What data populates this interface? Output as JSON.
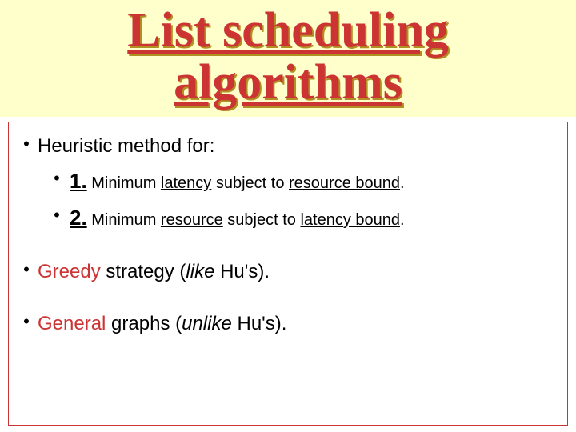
{
  "title": {
    "line1": "List scheduling",
    "line2": "algorithms"
  },
  "content": {
    "heuristic_label": "Heuristic method for:",
    "item1": {
      "num": "1.",
      "pre": " Minimum ",
      "latency": "latency",
      "mid": " subject to ",
      "bound": "resource bound",
      "end": "."
    },
    "item2": {
      "num": "2.",
      "pre": " Minimum ",
      "resource": "resource",
      "mid": " subject to ",
      "bound": "latency bound",
      "end": "."
    },
    "greedy": {
      "greedy": "Greedy",
      "strategy": " strategy (",
      "like": "like",
      "rest": " Hu's)."
    },
    "general": {
      "general": "General",
      "graphs": " graphs (",
      "unlike": "unlike",
      "rest": " Hu's)."
    }
  }
}
